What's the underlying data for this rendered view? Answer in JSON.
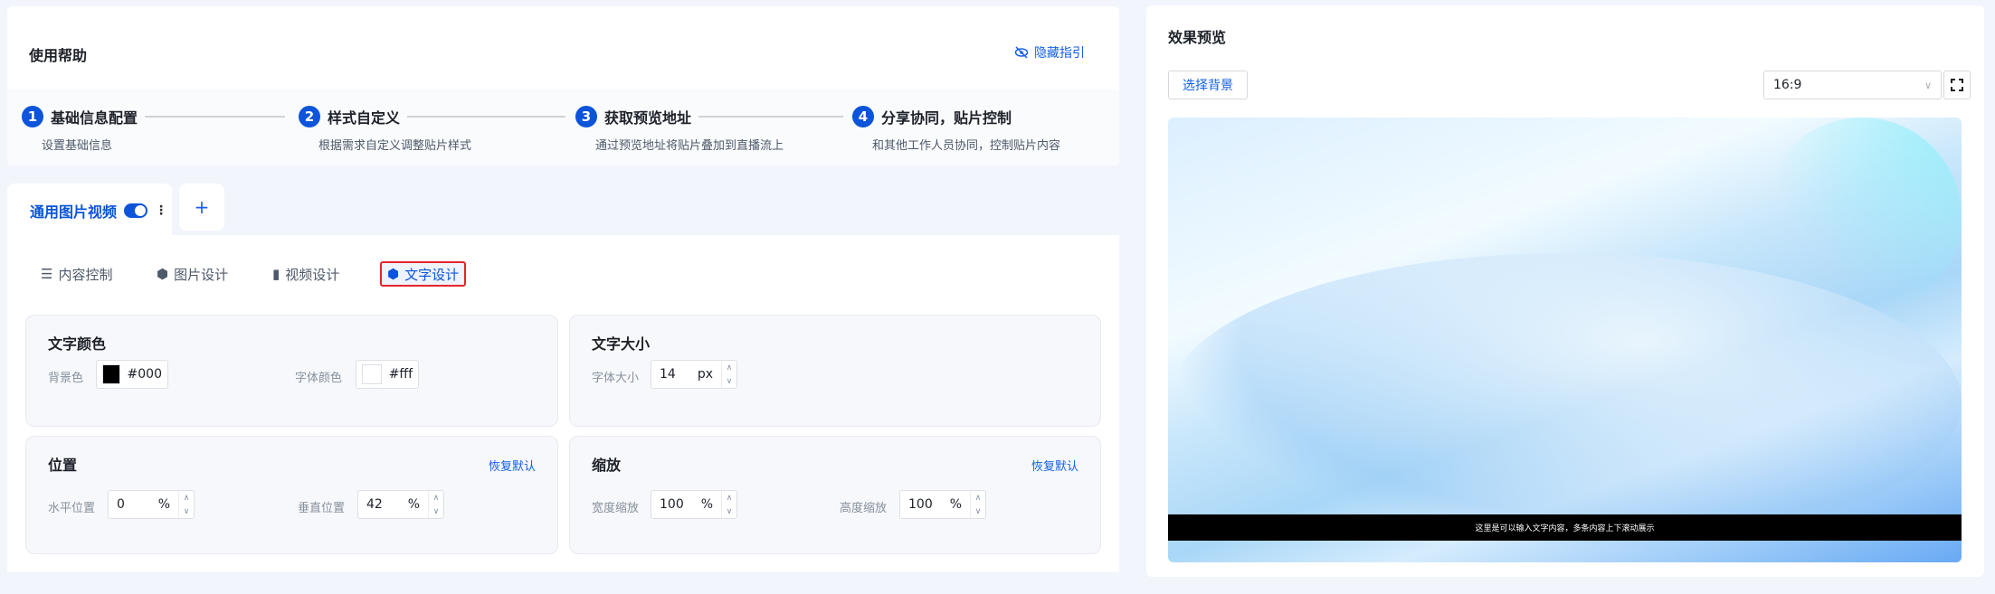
{
  "help": {
    "title": "使用帮助",
    "hide_label": "隐藏指引",
    "steps": [
      {
        "num": "1",
        "name": "基础信息配置",
        "desc": "设置基础信息"
      },
      {
        "num": "2",
        "name": "样式自定义",
        "desc": "根据需求自定义调整贴片样式"
      },
      {
        "num": "3",
        "name": "获取预览地址",
        "desc": "通过预览地址将贴片叠加到直播流上"
      },
      {
        "num": "4",
        "name": "分享协同，贴片控制",
        "desc": "和其他工作人员协同，控制贴片内容"
      }
    ]
  },
  "tabs": {
    "main_label": "通用图片视频",
    "toggle_on": true,
    "add_label": "+"
  },
  "subtabs": [
    "内容控制",
    "图片设计",
    "视频设计",
    "文字设计"
  ],
  "active_subtab": "文字设计",
  "text_color": {
    "title": "文字颜色",
    "bg_label": "背景色",
    "bg_value": "#000",
    "font_label": "字体颜色",
    "font_value": "#fff"
  },
  "text_size": {
    "title": "文字大小",
    "label": "字体大小",
    "value": "14",
    "unit": "px"
  },
  "position": {
    "title": "位置",
    "reset": "恢复默认",
    "h_label": "水平位置",
    "h_value": "0",
    "v_label": "垂直位置",
    "v_value": "42",
    "unit": "%"
  },
  "scale": {
    "title": "缩放",
    "reset": "恢复默认",
    "w_label": "宽度缩放",
    "w_value": "100",
    "h_label": "高度缩放",
    "h_value": "100",
    "unit": "%"
  },
  "preview": {
    "title": "效果预览",
    "select_bg": "选择背景",
    "ratio": "16:9",
    "caption": "这里是可以输入文字内容，多条内容上下滚动展示"
  },
  "colors": {
    "primary": "#0c54d9",
    "highlight": "#e5252a"
  }
}
